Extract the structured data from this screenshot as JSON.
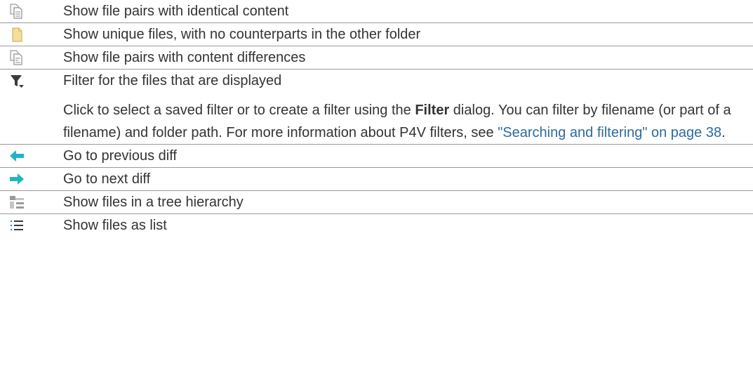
{
  "rows": [
    {
      "icon": "identical-files-icon",
      "label": "Show file pairs with identical content"
    },
    {
      "icon": "unique-file-icon",
      "label": "Show unique files, with no counterparts in the other folder"
    },
    {
      "icon": "different-files-icon",
      "label": "Show file pairs with content differences"
    },
    {
      "icon": "filter-icon",
      "label": "Filter for the files that are displayed",
      "desc_before": "Click to select a saved filter or to create a filter using the ",
      "desc_bold": "Filter",
      "desc_after": " dialog. You can filter by filename (or part of a filename) and folder path. For more information about P4V filters, see ",
      "desc_link": "\"Searching and filtering\" on page 38",
      "desc_end": "."
    },
    {
      "icon": "previous-diff-arrow-icon",
      "label": "Go to previous diff"
    },
    {
      "icon": "next-diff-arrow-icon",
      "label": "Go to next diff"
    },
    {
      "icon": "tree-hierarchy-icon",
      "label": "Show files in a tree hierarchy"
    },
    {
      "icon": "list-view-icon",
      "label": "Show files as list"
    }
  ],
  "colors": {
    "text": "#333333",
    "link": "#2d6aa0",
    "arrow": "#1fb5c7",
    "rule": "#9a9a9a"
  }
}
